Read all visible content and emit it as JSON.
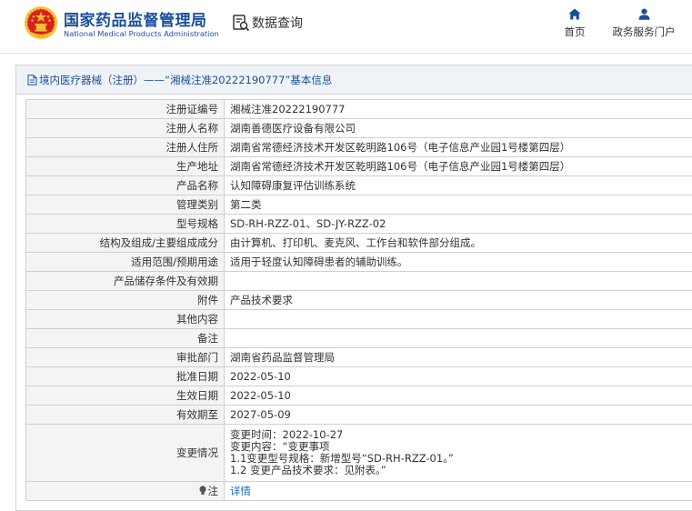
{
  "header": {
    "brand_cn": "国家药品监督管理局",
    "brand_en": "National Medical Products Administration",
    "data_query_label": "数据查询",
    "nav": [
      {
        "label": "首页",
        "icon": "home-icon"
      },
      {
        "label": "政务服务门户",
        "icon": "user-icon"
      }
    ]
  },
  "colors": {
    "brand_blue": "#1a4f9c",
    "link_blue": "#1a6dc4",
    "emblem_red": "#d92020",
    "emblem_gold": "#f2c230"
  },
  "panel": {
    "title": "境内医疗器械（注册）——“湘械注准20222190777”基本信息"
  },
  "rows": [
    {
      "label": "注册证编号",
      "value": "湘械注准20222190777"
    },
    {
      "label": "注册人名称",
      "value": "湖南善德医疗设备有限公司"
    },
    {
      "label": "注册人住所",
      "value": "湖南省常德经济技术开发区乾明路106号（电子信息产业园1号楼第四层）"
    },
    {
      "label": "生产地址",
      "value": "湖南省常德经济技术开发区乾明路106号（电子信息产业园1号楼第四层）"
    },
    {
      "label": "产品名称",
      "value": "认知障碍康复评估训练系统"
    },
    {
      "label": "管理类别",
      "value": "第二类"
    },
    {
      "label": "型号规格",
      "value": "SD-RH-RZZ-01、SD-JY-RZZ-02"
    },
    {
      "label": "结构及组成/主要组成成分",
      "value": "由计算机、打印机、麦克风、工作台和软件部分组成。"
    },
    {
      "label": "适用范围/预期用途",
      "value": "适用于轻度认知障碍患者的辅助训练。"
    },
    {
      "label": "产品储存条件及有效期",
      "value": ""
    },
    {
      "label": "附件",
      "value": "产品技术要求"
    },
    {
      "label": "其他内容",
      "value": ""
    },
    {
      "label": "备注",
      "value": ""
    },
    {
      "label": "审批部门",
      "value": "湖南省药品监督管理局"
    },
    {
      "label": "批准日期",
      "value": "2022-05-10"
    },
    {
      "label": "生效日期",
      "value": "2022-05-10"
    },
    {
      "label": "有效期至",
      "value": "2027-05-09"
    }
  ],
  "change": {
    "label": "变更情况",
    "lines": [
      "变更时间：2022-10-27",
      "变更内容：“变更事项",
      "1.1变更型号规格：新增型号“SD-RH-RZZ-01。”",
      "1.2 变更产品技术要求：见附表。”"
    ]
  },
  "note": {
    "label": "注",
    "link_text": "详情"
  }
}
